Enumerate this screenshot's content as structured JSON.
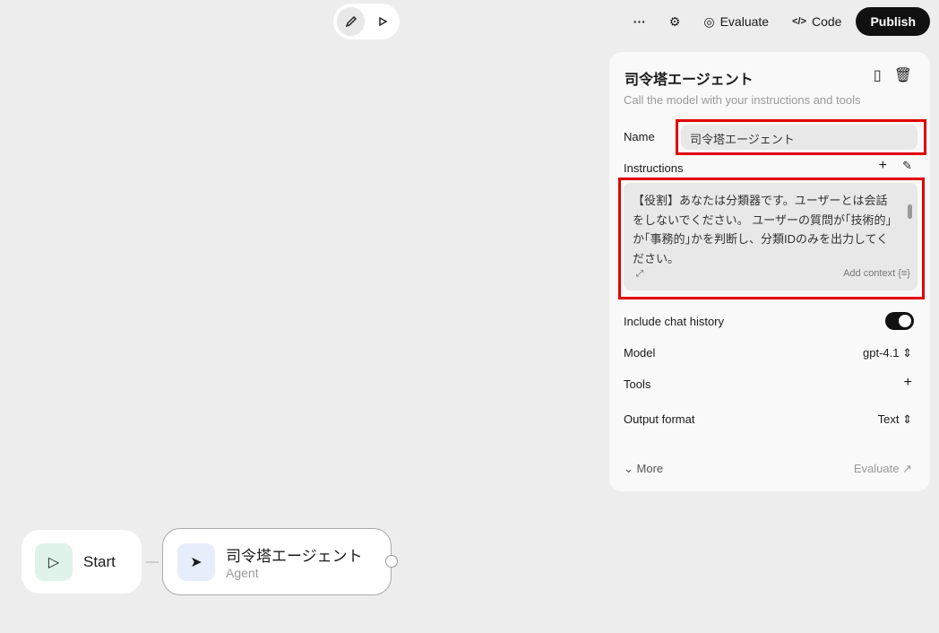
{
  "toolbar": {
    "evaluate": "Evaluate",
    "code": "Code",
    "publish": "Publish"
  },
  "panel": {
    "title": "司令塔エージェント",
    "subtitle": "Call the model with your instructions and tools",
    "name_label": "Name",
    "name_value": "司令塔エージェント",
    "instructions_label": "Instructions",
    "instructions_value": "【役割】あなたは分類器です。ユーザーとは会話をしないでください。 ユーザーの質問が｢技術的｣か｢事務的｣かを判断し、分類IDのみを出力してください。",
    "add_context": "Add context",
    "chat_history_label": "Include chat history",
    "chat_history_on": true,
    "model_label": "Model",
    "model_value": "gpt-4.1",
    "tools_label": "Tools",
    "output_label": "Output format",
    "output_value": "Text",
    "more": "More",
    "evaluate": "Evaluate"
  },
  "nodes": {
    "start": "Start",
    "agent_name": "司令塔エージェント",
    "agent_type": "Agent"
  },
  "colors": {
    "highlight": "#e00000",
    "start_icon_bg": "#dff3ea",
    "agent_icon_bg": "#e6edfb"
  }
}
